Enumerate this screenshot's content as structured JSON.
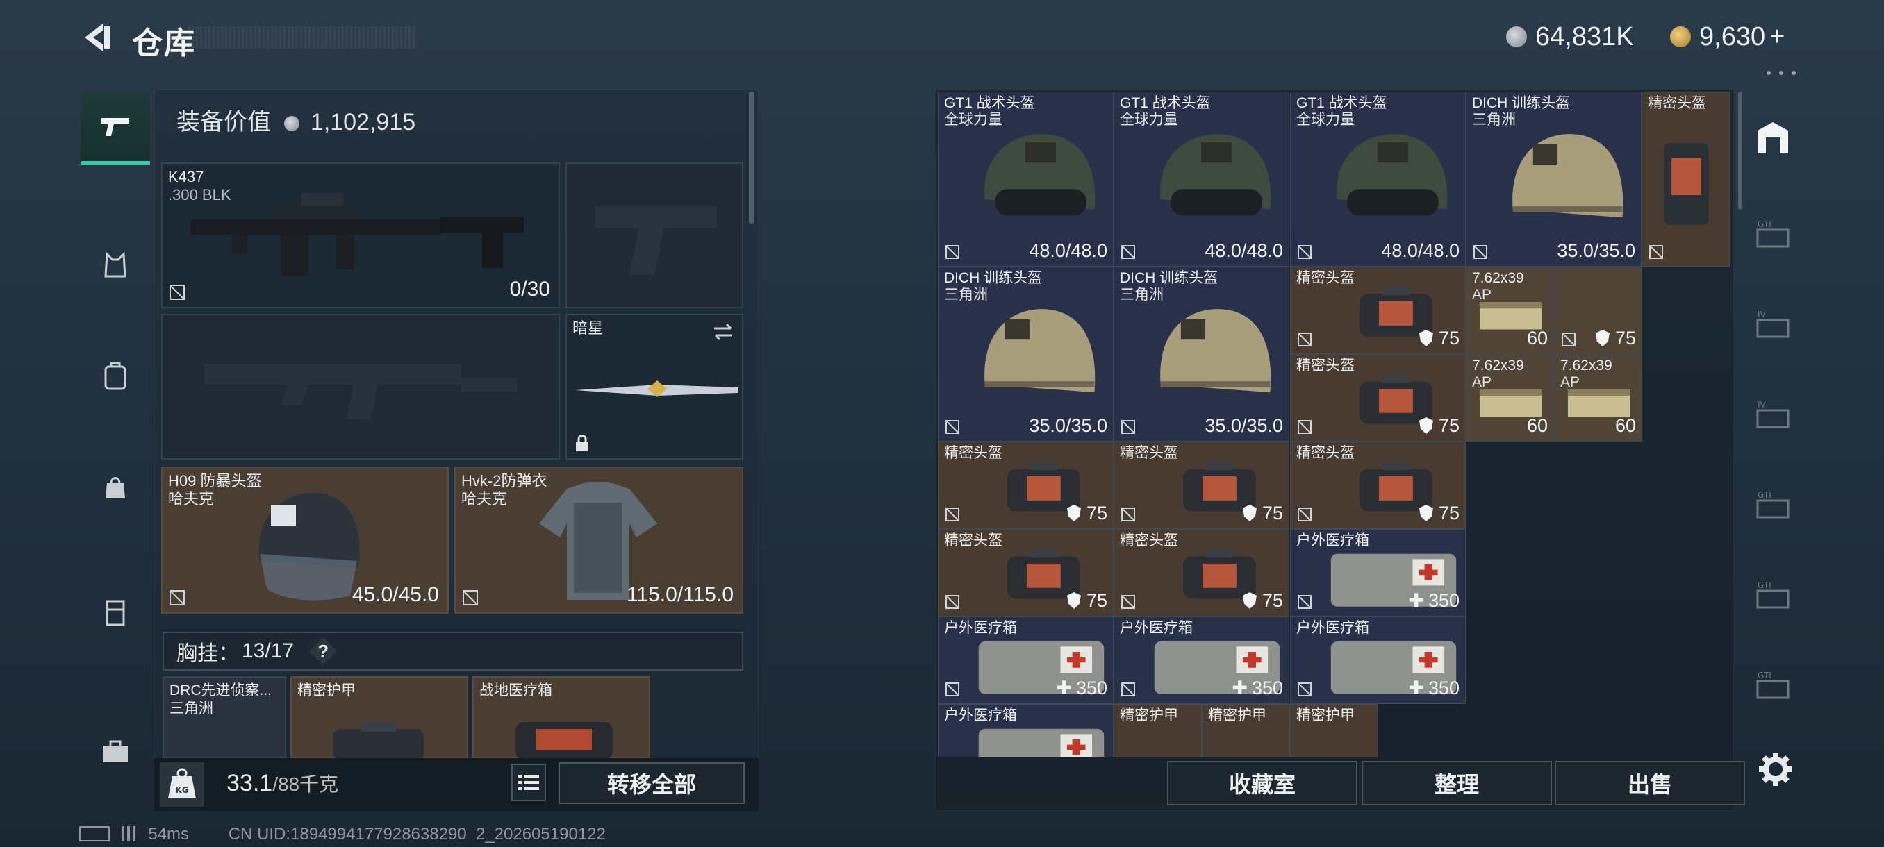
{
  "header": {
    "title": "仓库",
    "currency_silver": "64,831K",
    "currency_gold": "9,630",
    "gold_add": "+"
  },
  "equip": {
    "label": "装备价值",
    "value": "1,102,915"
  },
  "slots": {
    "primary": {
      "name": "K437",
      "sub": ".300 BLK",
      "ammo": "0/30"
    },
    "melee": {
      "name": "暗星"
    },
    "helmet": {
      "name": "H09 防暴头盔",
      "sub": "哈夫克",
      "durability": "45.0/45.0"
    },
    "armor": {
      "name": "Hvk-2防弹衣",
      "sub": "哈夫克",
      "durability": "115.0/115.0"
    }
  },
  "chestrig": {
    "label": "胸挂：",
    "count": "13/17",
    "help": "?"
  },
  "rig_items": [
    {
      "name": "DRC先进侦察...",
      "sub": "三角洲"
    },
    {
      "name": "精密护甲",
      "sub": ""
    },
    {
      "name": "战地医疗箱",
      "sub": ""
    }
  ],
  "weight": {
    "current": "33.1",
    "max": "/88千克"
  },
  "buttons": {
    "transfer_all": "转移全部",
    "collection": "收藏室",
    "organize": "整理",
    "sell": "出售"
  },
  "status": {
    "ping": "54ms",
    "uid": "CN UID:1894994177928638290 2_202605190122"
  },
  "grid": [
    {
      "name": "GT1 战术头盔",
      "sub": "全球力量",
      "val": "48.0/48.0"
    },
    {
      "name": "GT1 战术头盔",
      "sub": "全球力量",
      "val": "48.0/48.0"
    },
    {
      "name": "GT1 战术头盔",
      "sub": "全球力量",
      "val": "48.0/48.0"
    },
    {
      "name": "DICH 训练头盔",
      "sub": "三角洲",
      "val": "35.0/35.0"
    },
    {
      "name": "精密头盔",
      "sub": "",
      "val": ""
    },
    {
      "name": "DICH 训练头盔",
      "sub": "三角洲",
      "val": "35.0/35.0"
    },
    {
      "name": "DICH 训练头盔",
      "sub": "三角洲",
      "val": "35.0/35.0"
    },
    {
      "name": "精密头盔",
      "sub": "",
      "val": "75"
    },
    {
      "name": "7.62x39",
      "sub": "AP",
      "val": "60"
    },
    {
      "name": "",
      "sub": "",
      "val": "75"
    },
    {
      "name": "精密头盔",
      "sub": "",
      "val": "75"
    },
    {
      "name": "7.62x39",
      "sub": "AP",
      "val": "60"
    },
    {
      "name": "7.62x39",
      "sub": "AP",
      "val": "60"
    },
    {
      "name": "精密头盔",
      "sub": "",
      "val": "75"
    },
    {
      "name": "精密头盔",
      "sub": "",
      "val": "75"
    },
    {
      "name": "精密头盔",
      "sub": "",
      "val": "75"
    },
    {
      "name": "精密头盔",
      "sub": "",
      "val": "75"
    },
    {
      "name": "精密头盔",
      "sub": "",
      "val": "75"
    },
    {
      "name": "户外医疗箱",
      "sub": "",
      "val": "350"
    },
    {
      "name": "户外医疗箱",
      "sub": "",
      "val": "350"
    },
    {
      "name": "户外医疗箱",
      "sub": "",
      "val": "350"
    },
    {
      "name": "户外医疗箱",
      "sub": "",
      "val": "350"
    },
    {
      "name": "户外医疗箱",
      "sub": "",
      "val": ""
    },
    {
      "name": "精密护甲",
      "sub": "",
      "val": ""
    },
    {
      "name": "精密护甲",
      "sub": "",
      "val": ""
    },
    {
      "name": "精密护甲",
      "sub": "",
      "val": ""
    }
  ],
  "colors": {
    "accent": "#33c9a8",
    "slot_brown": "#4a3e33",
    "cell_blue": "#28304a",
    "cell_brown": "#4a3b30"
  }
}
